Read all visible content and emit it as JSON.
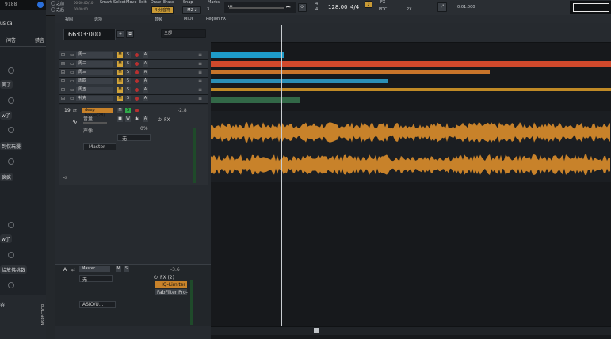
{
  "chat": {
    "header_number": "9188",
    "header_label": "usica",
    "tab_left": "问答",
    "tab_right": "禁言",
    "messages": [
      "美了",
      "w了",
      "到仅玩漫",
      "疯疯",
      "w了",
      "给放佛挑数",
      "谷"
    ]
  },
  "transport": {
    "left_labels": [
      "之前",
      "之后"
    ],
    "left_times": [
      "00:00:00/10",
      "00:00:00"
    ],
    "tools": [
      "Smart",
      "Select",
      "Move",
      "Edit",
      "Draw",
      "Erase"
    ],
    "snap_label": "Snap",
    "snap_value": "4 分音符",
    "marks_label": "Marks",
    "grid_value": "M2 ♩",
    "grid_num": "3",
    "signature_top": "4",
    "signature_bottom": "4",
    "bpm": "128.00",
    "meter": "4/4",
    "fx_label": "FX",
    "pdc_label": "PDC",
    "rate_label": "2X",
    "right_time": "0:01:000"
  },
  "toolrow": {
    "menus": [
      "视图",
      "选项",
      "音频",
      "MIDI",
      "Region FX"
    ]
  },
  "tracks_header": {
    "time": "66:03:000",
    "filter": "全部"
  },
  "tracks": [
    {
      "name": "周一",
      "color": "#1e9bc9"
    },
    {
      "name": "周二",
      "color": "#d0492c"
    },
    {
      "name": "周三",
      "color": "#c8742a"
    },
    {
      "name": "周四",
      "color": "#2b8fb5"
    },
    {
      "name": "周五",
      "color": "#c08a26"
    },
    {
      "name": "补充",
      "color": "#3e8a5a"
    }
  ],
  "selected_track": {
    "number": "19",
    "name": "deep house(28)",
    "volume_label": "音量",
    "pan_label": "声像",
    "volume_value": "-2.8",
    "pan_value": "0%",
    "fx_label": "FX",
    "send_label": "-无-",
    "output": "Master"
  },
  "master_bus": {
    "label": "Master",
    "input": "无",
    "volume_value": "-3.6",
    "fx_label": "FX (2)",
    "plugin_1": "IQ-Limiter",
    "plugin_2": "FabFilter Pro-",
    "output": "ASIO/U..."
  },
  "inspector_label": "INSPECTOR",
  "colors": {
    "waveform": "#c8822a",
    "mute_active": "#d2a43a",
    "solo": "#3a3f45",
    "record": "#b83030",
    "monitor_green": "#2fa84a"
  }
}
